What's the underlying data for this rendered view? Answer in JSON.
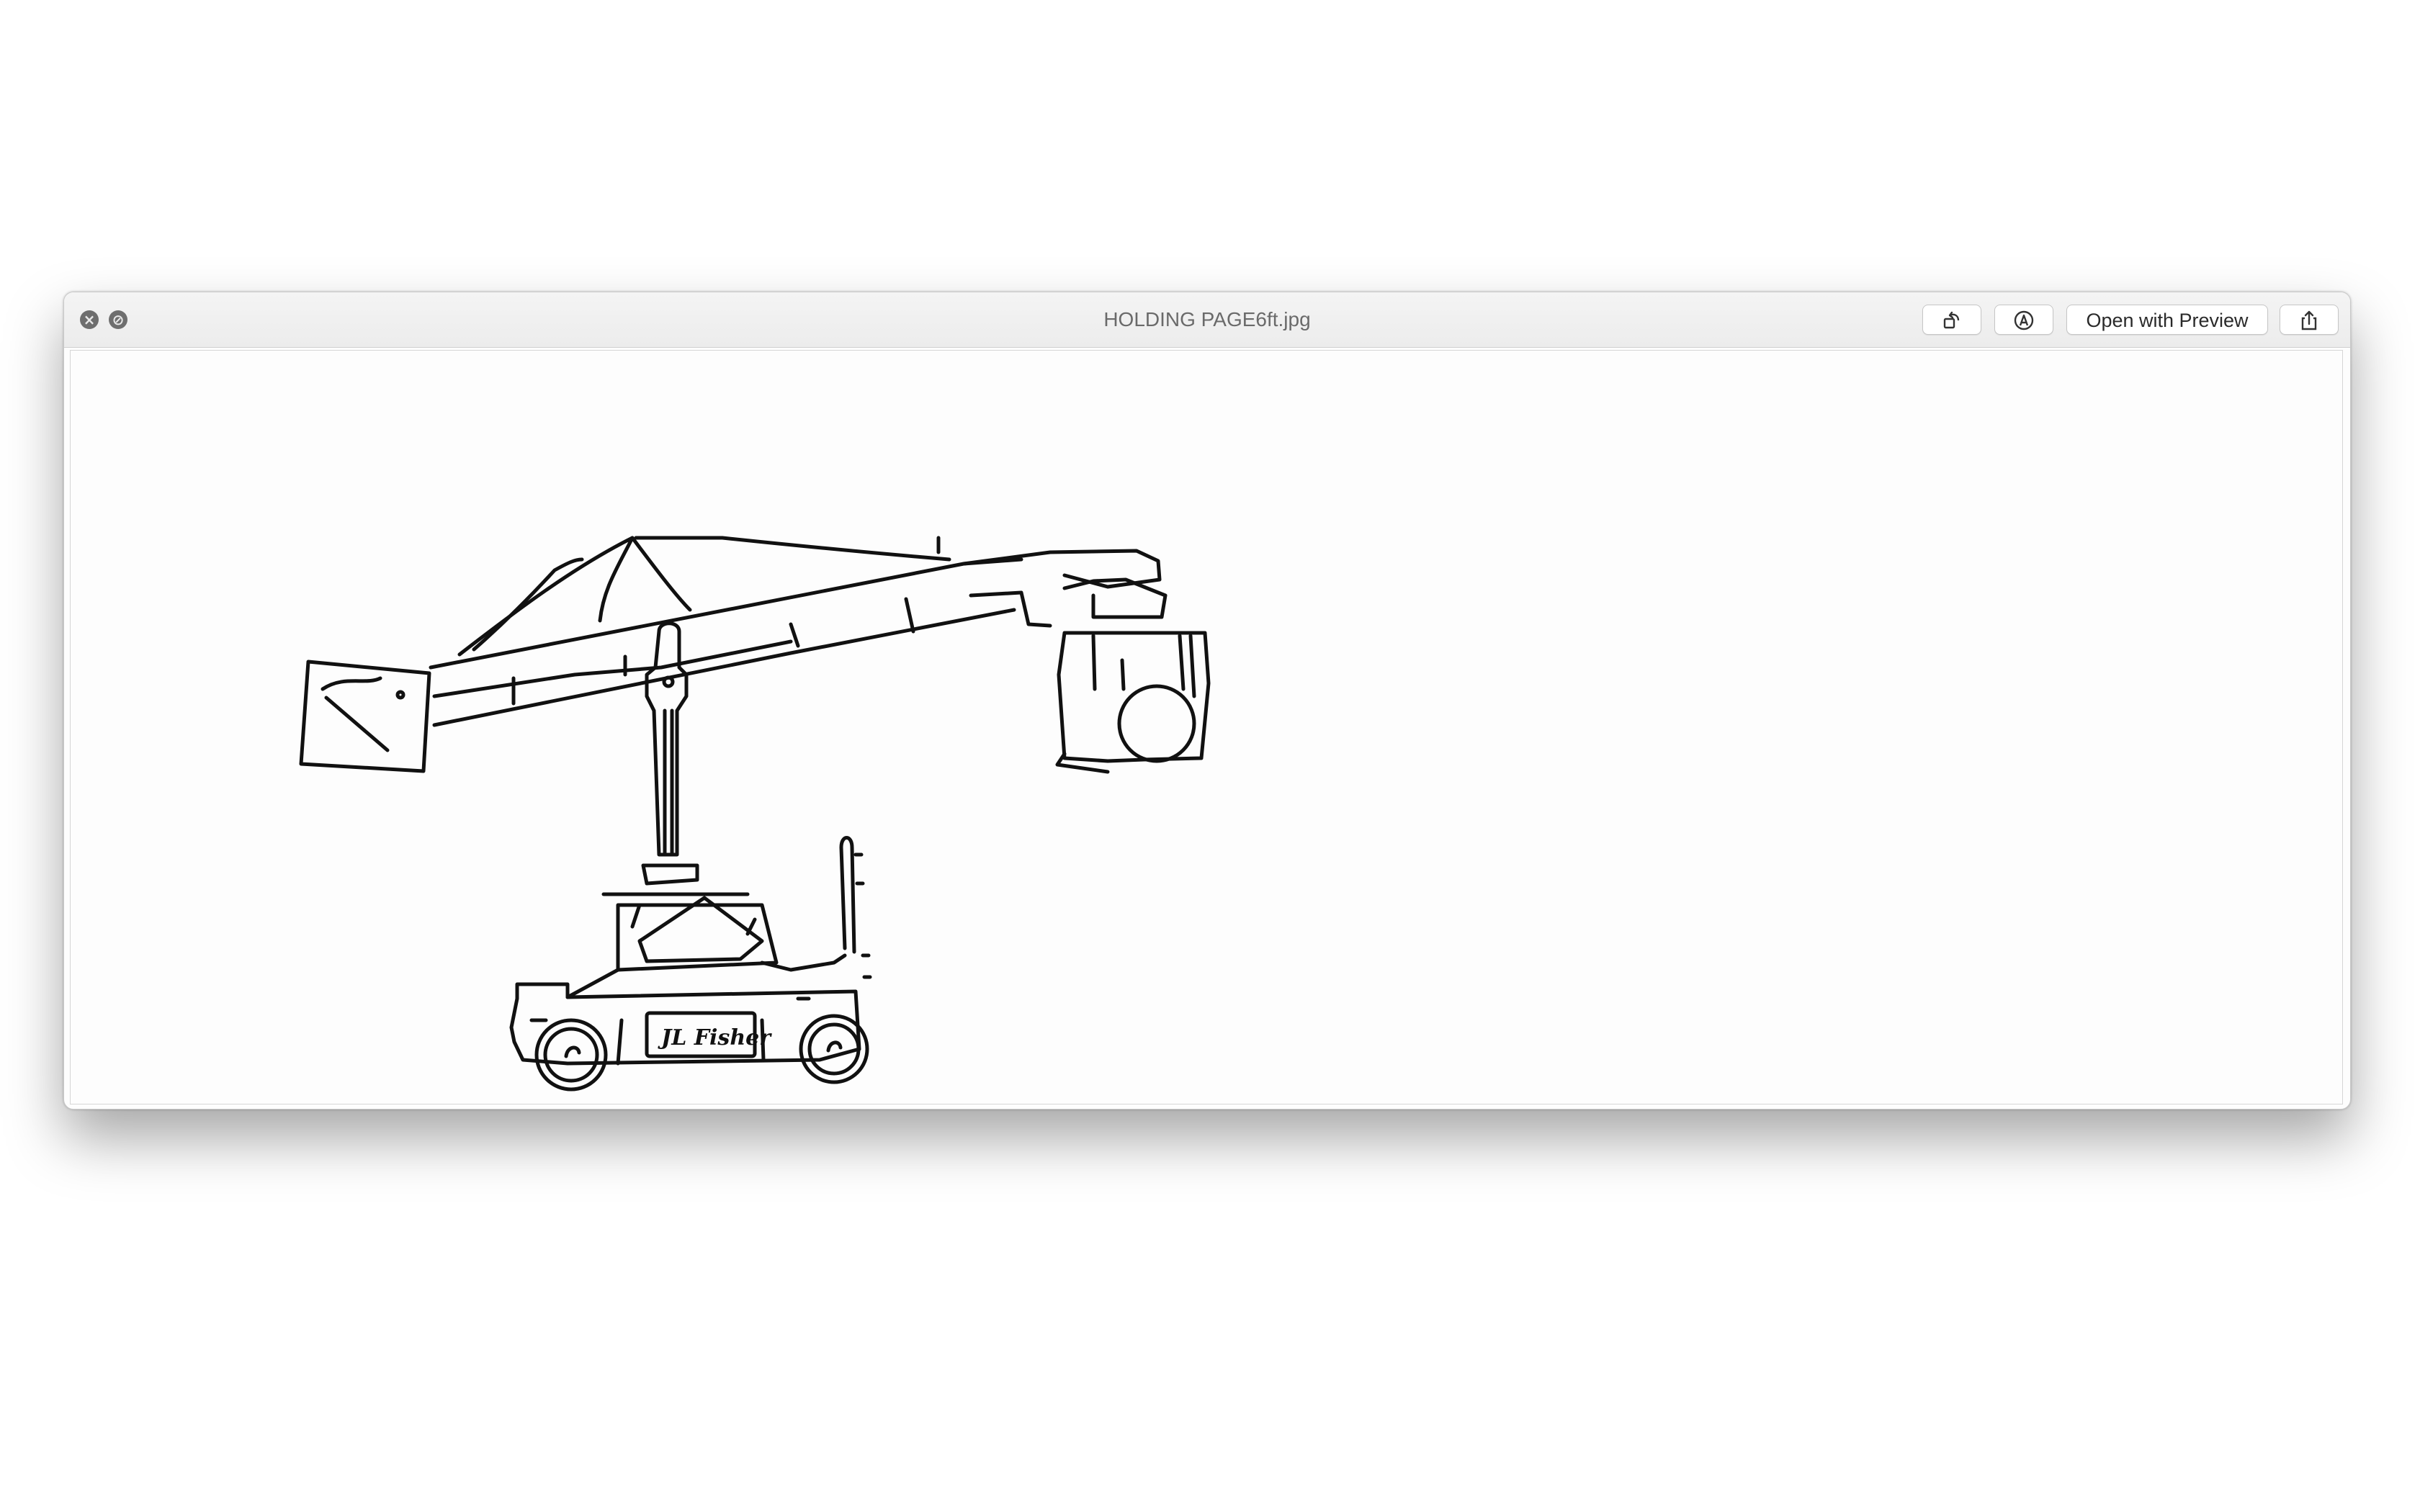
{
  "window": {
    "title": "HOLDING PAGE6ft.jpg",
    "controls": {
      "close_glyph": "×",
      "fullscreen_glyph": "⊘"
    }
  },
  "toolbar": {
    "rotate_icon": "rotate-left-icon",
    "markup_icon": "markup-pen-icon",
    "open_label": "Open with Preview",
    "share_icon": "share-icon"
  },
  "image": {
    "subject": "crane-sketch",
    "logo_text": "JL Fisher"
  }
}
